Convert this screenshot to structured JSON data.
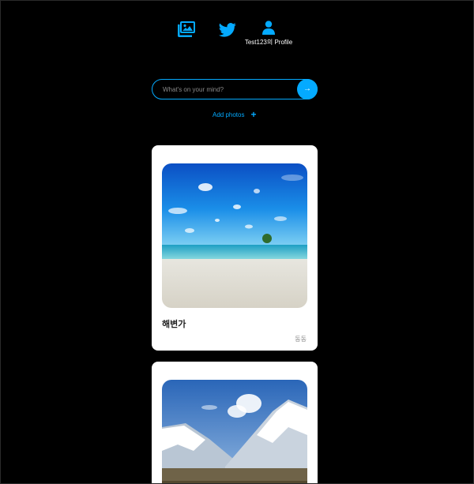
{
  "nav": {
    "icons": {
      "photos": "photo-album-icon",
      "home": "twitter-bird-icon",
      "profile": "user-icon"
    },
    "profile_label": "Test123의 Profile",
    "accent_color": "#04aaff"
  },
  "form": {
    "placeholder": "What's on your mind?",
    "submit_glyph": "→",
    "add_photos_label": "Add photos",
    "add_photos_glyph": "+"
  },
  "feed": {
    "items": [
      {
        "text": "해변가",
        "author": "동동",
        "image": "beach-photo"
      },
      {
        "text": "",
        "author": "",
        "image": "mountain-photo"
      }
    ]
  },
  "colors": {
    "background": "#000000",
    "card": "#ffffff",
    "accent": "#04aaff"
  }
}
